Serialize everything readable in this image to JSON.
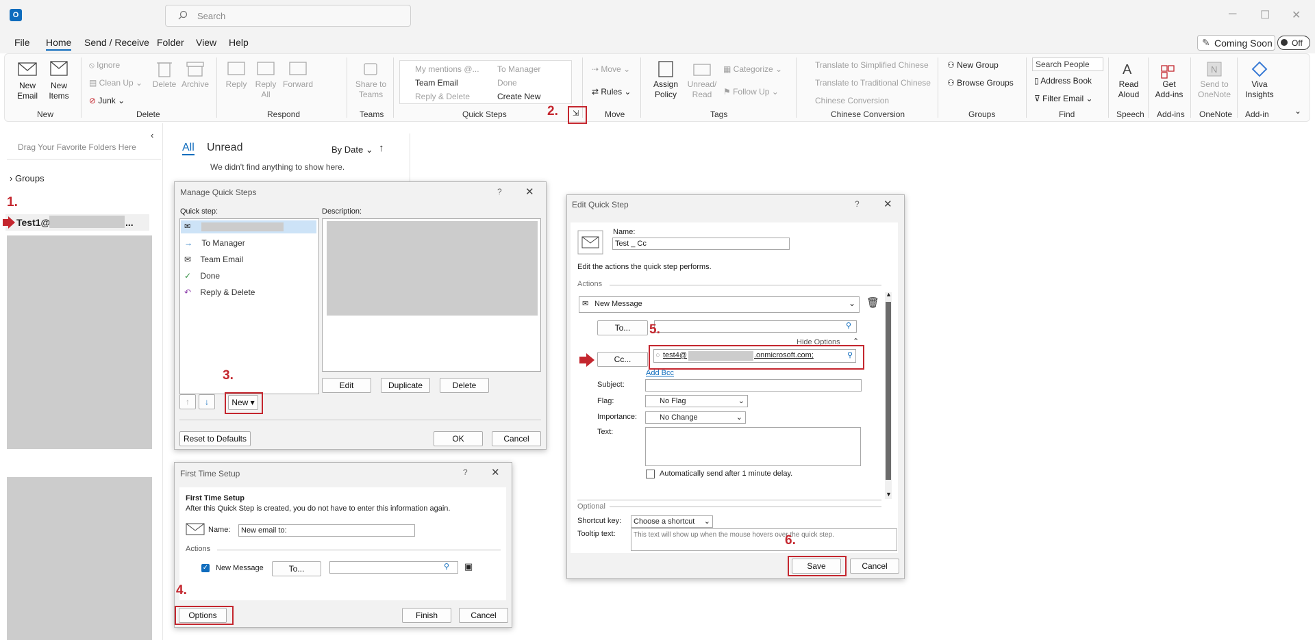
{
  "app": {
    "search_placeholder": "Search"
  },
  "menu": [
    "File",
    "Home",
    "Send / Receive",
    "Folder",
    "View",
    "Help"
  ],
  "toggles": {
    "coming_soon": "Coming Soon",
    "off": "Off"
  },
  "ribbon": {
    "new_email": "New Email",
    "new_items": "New Items",
    "ignore": "Ignore",
    "clean_up": "Clean Up",
    "junk": "Junk",
    "delete": "Delete",
    "archive": "Archive",
    "reply": "Reply",
    "reply_all": "Reply All",
    "forward": "Forward",
    "share_teams": "Share to Teams",
    "qs_my_mentions": "My mentions @...",
    "qs_to_manager": "To Manager",
    "qs_team_email": "Team Email",
    "qs_done": "Done",
    "qs_reply_delete": "Reply & Delete",
    "qs_create_new": "Create New",
    "move": "Move",
    "rules": "Rules",
    "assign_policy": "Assign Policy",
    "unread_read": "Unread/ Read",
    "categorize": "Categorize",
    "follow_up": "Follow Up",
    "translate_simplified": "Translate to Simplified Chinese",
    "translate_traditional": "Translate to Traditional Chinese",
    "chinese_conversion": "Chinese Conversion",
    "new_group": "New Group",
    "browse_groups": "Browse Groups",
    "search_people": "Search People",
    "address_book": "Address Book",
    "filter_email": "Filter Email",
    "read_aloud": "Read Aloud",
    "get_addins": "Get Add-ins",
    "send_onenote": "Send to OneNote",
    "viva_insights": "Viva Insights",
    "groups_labels": [
      "New",
      "Delete",
      "Respond",
      "Teams",
      "Quick Steps",
      "Move",
      "Tags",
      "Chinese Conversion",
      "Groups",
      "Find",
      "Speech",
      "Add-ins",
      "OneNote",
      "Add-in"
    ]
  },
  "annotations": [
    "1.",
    "2.",
    "3.",
    "4.",
    "5.",
    "6."
  ],
  "leftnav": {
    "drag_hint": "Drag Your Favorite Folders Here",
    "groups": "Groups",
    "account": "Test1@"
  },
  "mail_list": {
    "tab_all": "All",
    "tab_unread": "Unread",
    "sort": "By Date",
    "empty": "We didn't find anything to show here."
  },
  "manage_qs": {
    "title": "Manage Quick Steps",
    "quick_step_label": "Quick step:",
    "description_label": "Description:",
    "items": [
      "To Manager",
      "Team Email",
      "Done",
      "Reply & Delete"
    ],
    "edit": "Edit",
    "duplicate": "Duplicate",
    "delete": "Delete",
    "new": "New",
    "reset": "Reset to Defaults",
    "ok": "OK",
    "cancel": "Cancel"
  },
  "first_setup": {
    "title": "First Time Setup",
    "heading": "First Time Setup",
    "desc": "After this Quick Step is created, you do not have to enter this information again.",
    "name_label": "Name:",
    "name_value": "New email to:",
    "actions_label": "Actions",
    "new_message": "New Message",
    "to_btn": "To...",
    "options": "Options",
    "finish": "Finish",
    "cancel": "Cancel"
  },
  "edit_qs": {
    "title": "Edit Quick Step",
    "name_label": "Name:",
    "name_value": "Test _ Cc",
    "edit_desc": "Edit the actions the quick step performs.",
    "actions_label": "Actions",
    "action_select": "New Message",
    "to_btn": "To...",
    "hide_options": "Hide Options",
    "cc_btn": "Cc...",
    "cc_prefix": "test4@",
    "cc_suffix": ".onmicrosoft.com;",
    "add_bcc": "Add Bcc",
    "subject_label": "Subject:",
    "flag_label": "Flag:",
    "flag_value": "No Flag",
    "importance_label": "Importance:",
    "importance_value": "No Change",
    "text_label": "Text:",
    "auto_send": "Automatically send after 1 minute delay.",
    "optional_label": "Optional",
    "shortcut_label": "Shortcut key:",
    "shortcut_value": "Choose a shortcut",
    "tooltip_label": "Tooltip text:",
    "tooltip_value": "This text will show up when the mouse hovers over the quick step.",
    "save": "Save",
    "cancel": "Cancel"
  },
  "colors": {
    "accent": "#0f6cbd",
    "annotation_red": "#c4262e",
    "redacted": "#cccccc"
  }
}
